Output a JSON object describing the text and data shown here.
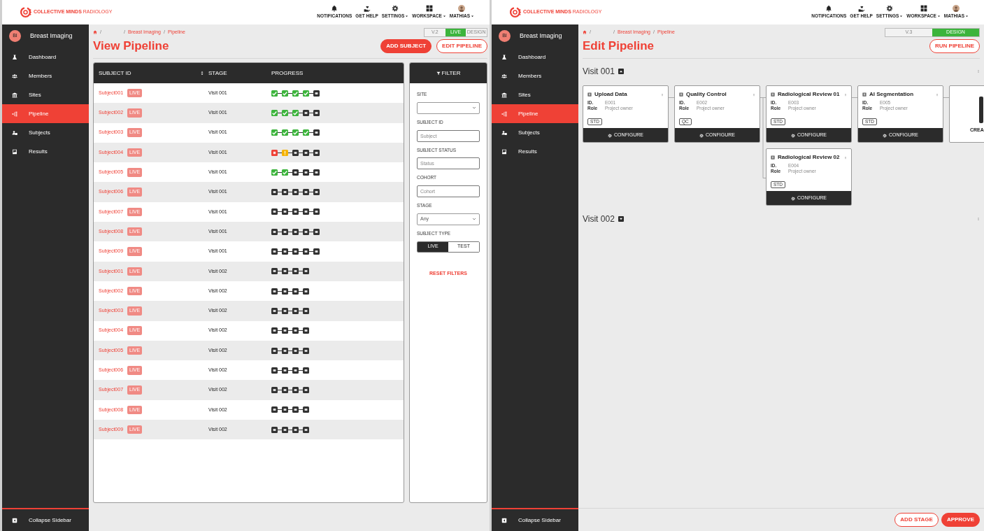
{
  "screens": [
    {
      "kind": "view",
      "header": {
        "logo": "**COLLECTIVE MINDS** RADIOLOGY",
        "nav": [
          {
            "label": "NOTIFICATIONS",
            "dropdown": false
          },
          {
            "label": "GET HELP",
            "dropdown": false
          },
          {
            "label": "SETTINGS",
            "dropdown": true
          },
          {
            "label": "WORKSPACE",
            "dropdown": true
          },
          {
            "label": "MATHIAS",
            "dropdown": true
          }
        ]
      },
      "sidebar": {
        "workspace": {
          "initials": "BI",
          "label": "Breast Imaging"
        },
        "items": [
          {
            "label": "Dashboard",
            "selected": false
          },
          {
            "label": "Members",
            "selected": false
          },
          {
            "label": "Sites",
            "selected": false
          },
          {
            "label": "Pipeline",
            "selected": true
          },
          {
            "label": "Subjects",
            "selected": false
          },
          {
            "label": "Results",
            "selected": false
          }
        ],
        "collapse": "Collapse Sidebar"
      },
      "breadcrumb": [
        {
          "kind": "home"
        },
        {
          "kind": "separator",
          "text": "/"
        },
        {
          "kind": "separator",
          "text": "/"
        },
        {
          "kind": "link",
          "text": "Breast Imaging"
        },
        {
          "kind": "separator",
          "text": "/"
        },
        {
          "kind": "link",
          "text": "Pipeline"
        }
      ],
      "version_toggle": [
        {
          "label": "V.2",
          "selected": false
        },
        {
          "label": "LIVE",
          "selected": true
        },
        {
          "label": "DESIGN",
          "selected": false
        }
      ],
      "title": "View Pipeline",
      "actions": [
        {
          "label": "ADD SUBJECT",
          "kind": "primary"
        },
        {
          "label": "EDIT PIPELINE",
          "kind": "outline"
        }
      ],
      "table": {
        "columns": [
          {
            "label": "SUBJECT ID",
            "sortable": true
          },
          {
            "label": "STAGE",
            "sortable": false
          },
          {
            "label": "PROGRESS",
            "sortable": false
          }
        ],
        "rows": [
          {
            "subject": "Subject001",
            "badge": "LIVE",
            "stage": "Visit 001",
            "progress": [
              {
                "kind": "done"
              },
              {
                "kind": "done"
              },
              {
                "kind": "done"
              },
              {
                "kind": "done"
              },
              {
                "kind": "pending"
              }
            ]
          },
          {
            "subject": "Subject002",
            "badge": "LIVE",
            "stage": "Visit 001",
            "progress": [
              {
                "kind": "done"
              },
              {
                "kind": "done"
              },
              {
                "kind": "done"
              },
              {
                "kind": "pending"
              },
              {
                "kind": "pending"
              }
            ]
          },
          {
            "subject": "Subject003",
            "badge": "LIVE",
            "stage": "Visit 001",
            "progress": [
              {
                "kind": "done"
              },
              {
                "kind": "done"
              },
              {
                "kind": "done"
              },
              {
                "kind": "done"
              },
              {
                "kind": "pending"
              }
            ]
          },
          {
            "subject": "Subject004",
            "badge": "LIVE",
            "stage": "Visit 001",
            "progress": [
              {
                "kind": "error"
              },
              {
                "kind": "warning"
              },
              {
                "kind": "pending"
              },
              {
                "kind": "pending"
              },
              {
                "kind": "pending"
              }
            ]
          },
          {
            "subject": "Subject005",
            "badge": "LIVE",
            "stage": "Visit 001",
            "progress": [
              {
                "kind": "done"
              },
              {
                "kind": "done"
              },
              {
                "kind": "pending"
              },
              {
                "kind": "pending"
              },
              {
                "kind": "pending"
              }
            ]
          },
          {
            "subject": "Subject006",
            "badge": "LIVE",
            "stage": "Visit 001",
            "progress": [
              {
                "kind": "pending"
              },
              {
                "kind": "pending"
              },
              {
                "kind": "pending"
              },
              {
                "kind": "pending"
              },
              {
                "kind": "pending"
              }
            ]
          },
          {
            "subject": "Subject007",
            "badge": "LIVE",
            "stage": "Visit 001",
            "progress": [
              {
                "kind": "pending"
              },
              {
                "kind": "pending"
              },
              {
                "kind": "pending"
              },
              {
                "kind": "pending"
              },
              {
                "kind": "pending"
              }
            ]
          },
          {
            "subject": "Subject008",
            "badge": "LIVE",
            "stage": "Visit 001",
            "progress": [
              {
                "kind": "pending"
              },
              {
                "kind": "pending"
              },
              {
                "kind": "pending"
              },
              {
                "kind": "pending"
              },
              {
                "kind": "pending"
              }
            ]
          },
          {
            "subject": "Subject009",
            "badge": "LIVE",
            "stage": "Visit 001",
            "progress": [
              {
                "kind": "pending"
              },
              {
                "kind": "pending"
              },
              {
                "kind": "pending"
              },
              {
                "kind": "pending"
              },
              {
                "kind": "pending"
              }
            ]
          },
          {
            "subject": "Subject001",
            "badge": "LIVE",
            "stage": "Visit 002",
            "progress": [
              {
                "kind": "pending"
              },
              {
                "kind": "pending"
              },
              {
                "kind": "pending"
              },
              {
                "kind": "pending"
              }
            ]
          },
          {
            "subject": "Subject002",
            "badge": "LIVE",
            "stage": "Visit 002",
            "progress": [
              {
                "kind": "pending"
              },
              {
                "kind": "pending"
              },
              {
                "kind": "pending"
              },
              {
                "kind": "pending"
              }
            ]
          },
          {
            "subject": "Subject003",
            "badge": "LIVE",
            "stage": "Visit 002",
            "progress": [
              {
                "kind": "pending"
              },
              {
                "kind": "pending"
              },
              {
                "kind": "pending"
              },
              {
                "kind": "pending"
              }
            ]
          },
          {
            "subject": "Subject004",
            "badge": "LIVE",
            "stage": "Visit 002",
            "progress": [
              {
                "kind": "pending"
              },
              {
                "kind": "pending"
              },
              {
                "kind": "pending"
              },
              {
                "kind": "pending"
              }
            ]
          },
          {
            "subject": "Subject005",
            "badge": "LIVE",
            "stage": "Visit 002",
            "progress": [
              {
                "kind": "pending"
              },
              {
                "kind": "pending"
              },
              {
                "kind": "pending"
              },
              {
                "kind": "pending"
              }
            ]
          },
          {
            "subject": "Subject006",
            "badge": "LIVE",
            "stage": "Visit 002",
            "progress": [
              {
                "kind": "pending"
              },
              {
                "kind": "pending"
              },
              {
                "kind": "pending"
              },
              {
                "kind": "pending"
              }
            ]
          },
          {
            "subject": "Subject007",
            "badge": "LIVE",
            "stage": "Visit 002",
            "progress": [
              {
                "kind": "pending"
              },
              {
                "kind": "pending"
              },
              {
                "kind": "pending"
              },
              {
                "kind": "pending"
              }
            ]
          },
          {
            "subject": "Subject008",
            "badge": "LIVE",
            "stage": "Visit 002",
            "progress": [
              {
                "kind": "pending"
              },
              {
                "kind": "pending"
              },
              {
                "kind": "pending"
              },
              {
                "kind": "pending"
              }
            ]
          },
          {
            "subject": "Subject009",
            "badge": "LIVE",
            "stage": "Visit 002",
            "progress": [
              {
                "kind": "pending"
              },
              {
                "kind": "pending"
              },
              {
                "kind": "pending"
              },
              {
                "kind": "pending"
              }
            ]
          }
        ]
      },
      "filter": {
        "title": "FILTER",
        "fields": [
          {
            "kind": "select",
            "label": "SITE"
          },
          {
            "kind": "input",
            "label": "SUBJECT ID",
            "placeholder": "Subject"
          },
          {
            "kind": "input",
            "label": "SUBJECT STATUS",
            "placeholder": "Status"
          },
          {
            "kind": "input",
            "label": "COHORT",
            "placeholder": "Cohort"
          },
          {
            "kind": "select",
            "label": "STAGE",
            "value": "Any"
          },
          {
            "kind": "toggle",
            "label": "SUBJECT TYPE",
            "options": [
              {
                "label": "LIVE",
                "selected": true
              },
              {
                "label": "TEST",
                "selected": false
              }
            ]
          }
        ],
        "reset": "RESET FILTERS"
      }
    },
    {
      "kind": "edit",
      "header": {
        "logo": "**COLLECTIVE MINDS** RADIOLOGY",
        "nav": [
          {
            "label": "NOTIFICATIONS",
            "dropdown": false
          },
          {
            "label": "GET HELP",
            "dropdown": false
          },
          {
            "label": "SETTINGS",
            "dropdown": true
          },
          {
            "label": "WORKSPACE",
            "dropdown": true
          },
          {
            "label": "MATHIAS",
            "dropdown": true
          }
        ]
      },
      "sidebar": {
        "workspace": {
          "initials": "BI",
          "label": "Breast Imaging"
        },
        "items": [
          {
            "label": "Dashboard",
            "selected": false
          },
          {
            "label": "Members",
            "selected": false
          },
          {
            "label": "Sites",
            "selected": false
          },
          {
            "label": "Pipeline",
            "selected": true
          },
          {
            "label": "Subjects",
            "selected": false
          },
          {
            "label": "Results",
            "selected": false
          }
        ],
        "collapse": "Collapse Sidebar"
      },
      "breadcrumb": [
        {
          "kind": "home"
        },
        {
          "kind": "separator",
          "text": "/"
        },
        {
          "kind": "separator",
          "text": "/"
        },
        {
          "kind": "link",
          "text": "Breast Imaging"
        },
        {
          "kind": "separator",
          "text": "/"
        },
        {
          "kind": "link",
          "text": "Pipeline"
        }
      ],
      "version_toggle": [
        {
          "label": "V.3",
          "selected": false
        },
        {
          "label": "DESIGN",
          "selected": true
        }
      ],
      "title": "Edit Pipeline",
      "actions": [
        {
          "label": "RUN PIPELINE",
          "kind": "outline"
        }
      ],
      "visits": [
        {
          "title": "Visit 001",
          "expanded": true,
          "columns": [
            {
              "cards": [
                {
                  "kind": "stage",
                  "title": "Upload Data",
                  "id_label": "ID.",
                  "id": "E001",
                  "role_label": "Role",
                  "role": "Project owner",
                  "tag": "STD",
                  "action": "CONFIGURE"
                }
              ]
            },
            {
              "cards": [
                {
                  "kind": "stage",
                  "title": "Quality Control",
                  "id_label": "ID.",
                  "id": "E002",
                  "role_label": "Role",
                  "role": "Project owner",
                  "tag": "QC",
                  "action": "CONFIGURE"
                }
              ]
            },
            {
              "cards": [
                {
                  "kind": "stage",
                  "title": "Radiological Review 01",
                  "id_label": "ID.",
                  "id": "E003",
                  "role_label": "Role",
                  "role": "Project owner",
                  "tag": "STD",
                  "action": "CONFIGURE"
                },
                {
                  "kind": "stage",
                  "title": "Radiological Review 02",
                  "id_label": "ID.",
                  "id": "E004",
                  "role_label": "Role",
                  "role": "Project owner",
                  "tag": "STD",
                  "action": "CONFIGURE"
                }
              ]
            },
            {
              "cards": [
                {
                  "kind": "stage",
                  "title": "AI Segmentation",
                  "id_label": "ID.",
                  "id": "E005",
                  "role_label": "Role",
                  "role": "Project owner",
                  "tag": "STD",
                  "action": "CONFIGURE"
                }
              ]
            },
            {
              "cards": [
                {
                  "kind": "create",
                  "label": "CREA"
                }
              ]
            }
          ]
        },
        {
          "title": "Visit 002",
          "expanded": false
        }
      ],
      "footer_actions": [
        {
          "label": "ADD STAGE",
          "kind": "outline"
        },
        {
          "label": "APPROVE",
          "kind": "primary"
        }
      ]
    }
  ]
}
